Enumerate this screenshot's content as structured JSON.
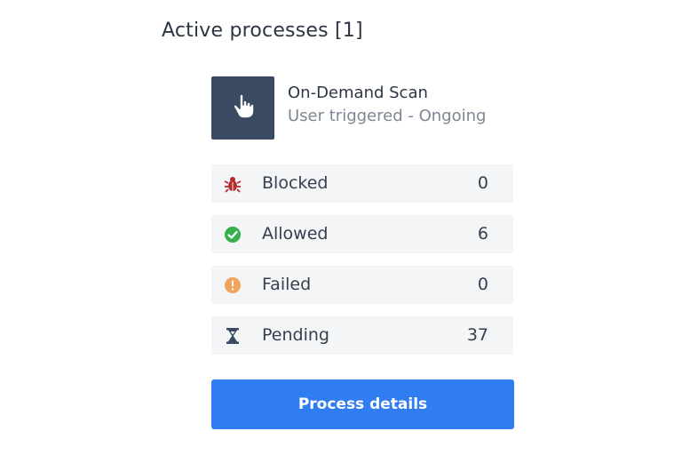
{
  "section": {
    "title": "Active processes [1]"
  },
  "process": {
    "icon": "pointing-hand-icon",
    "name": "On-Demand Scan",
    "status": "User triggered - Ongoing"
  },
  "stats": [
    {
      "label": "Blocked",
      "value": "0",
      "icon": "bug-icon",
      "color": "#b62b2b"
    },
    {
      "label": "Allowed",
      "value": "6",
      "icon": "check-circle-icon",
      "color": "#35b04a"
    },
    {
      "label": "Failed",
      "value": "0",
      "icon": "warning-circle-icon",
      "color": "#f1a45b"
    },
    {
      "label": "Pending",
      "value": "37",
      "icon": "hourglass-icon",
      "color": "#3b4a63"
    }
  ],
  "button": {
    "label": "Process details"
  },
  "colors": {
    "primary": "#2f7df0",
    "icon_tile": "#3b4a63",
    "row_background": "#f4f5f7"
  }
}
